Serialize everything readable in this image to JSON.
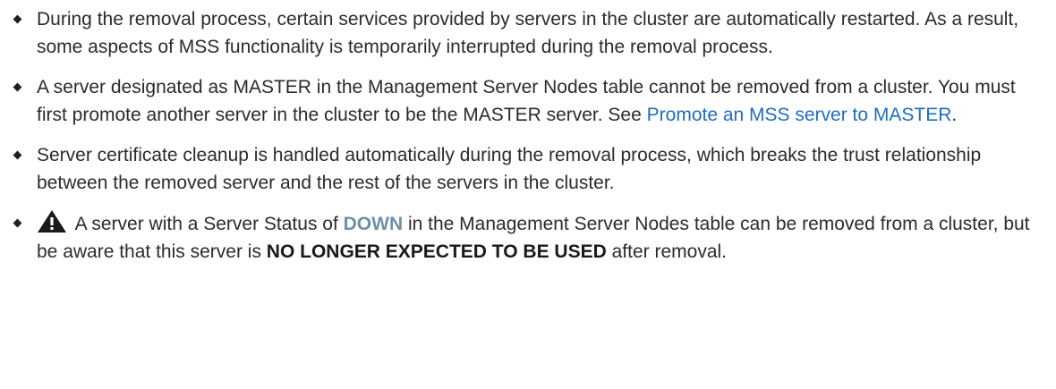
{
  "items": [
    {
      "text": "During the removal process, certain services provided by servers in the cluster are automatically restarted. As a result, some aspects of MSS functionality is temporarily interrupted during the removal process."
    },
    {
      "text_before": "A server designated as MASTER in the Management Server Nodes table cannot be removed from a cluster. You must first promote another server in the cluster to be the MASTER server. See ",
      "link": "Promote an MSS server to MASTER",
      "text_after": "."
    },
    {
      "text": "Server certificate cleanup is handled automatically during the removal process, which breaks the trust relationship between the removed server and the rest of the servers in the cluster."
    },
    {
      "icon": "warning-icon",
      "text_before": " A server with a Server Status of ",
      "status": "DOWN",
      "text_middle": " in the Management Server Nodes table can be removed from a cluster, but be aware that this server is ",
      "emphasis": "NO LONGER EXPECTED TO BE USED",
      "text_after": " after removal."
    }
  ],
  "colors": {
    "link": "#1f6dbf",
    "status_down": "#6e8fa8",
    "text": "#2b2b2b"
  }
}
